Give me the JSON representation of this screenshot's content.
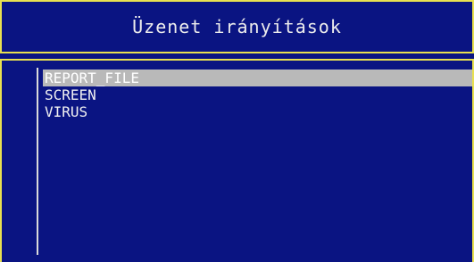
{
  "window": {
    "title": "Üzenet irányítások"
  },
  "list": {
    "items": [
      {
        "label": "REPORT_FILE",
        "selected": true
      },
      {
        "label": "SCREEN",
        "selected": false
      },
      {
        "label": "VIRUS",
        "selected": false
      }
    ]
  },
  "colors": {
    "background": "#0A1482",
    "border": "#E8E050",
    "text": "#F2F2F2",
    "selection": "#B9B9B9"
  }
}
